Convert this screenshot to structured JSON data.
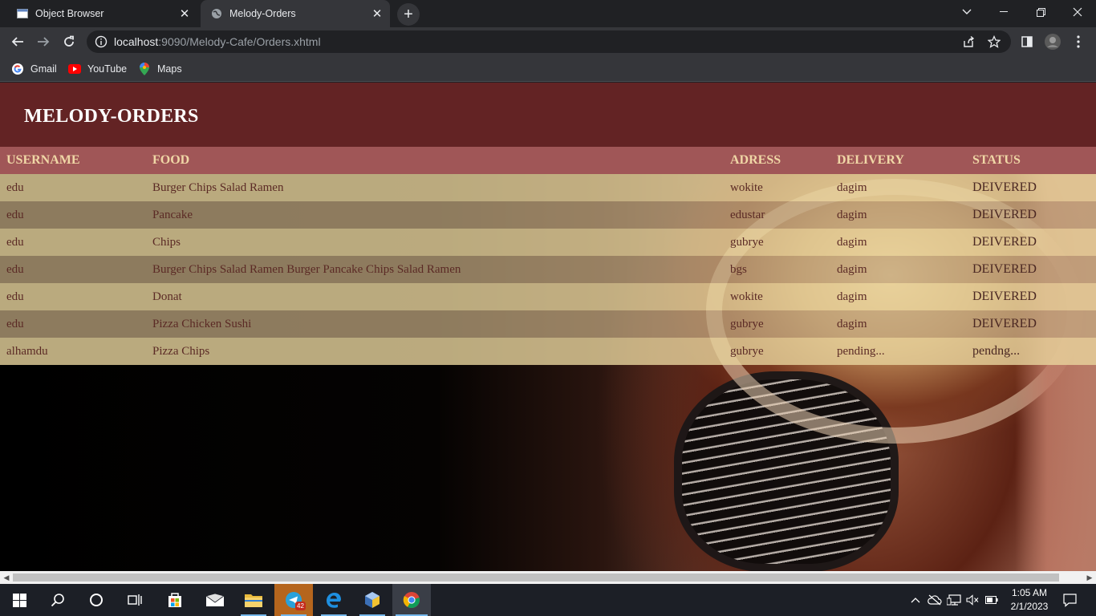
{
  "browser": {
    "tabs": [
      {
        "title": "Object Browser",
        "favicon": "window-icon",
        "active": false
      },
      {
        "title": "Melody-Orders",
        "favicon": "globe-icon",
        "active": true
      }
    ],
    "address": {
      "host": "localhost",
      "rest": ":9090/Melody-Cafe/Orders.xhtml"
    },
    "bookmarks": [
      {
        "label": "Gmail",
        "icon": "google-icon"
      },
      {
        "label": "YouTube",
        "icon": "youtube-icon"
      },
      {
        "label": "Maps",
        "icon": "maps-icon"
      }
    ]
  },
  "page": {
    "title": "MELODY-ORDERS",
    "columns": [
      "USERNAME",
      "FOOD",
      "ADRESS",
      "DELIVERY",
      "STATUS"
    ],
    "rows": [
      {
        "username": "edu",
        "food": "Burger Chips Salad Ramen",
        "address": "wokite",
        "delivery": "dagim",
        "status": "DEIVERED"
      },
      {
        "username": "edu",
        "food": "Pancake",
        "address": "edustar",
        "delivery": "dagim",
        "status": "DEIVERED"
      },
      {
        "username": "edu",
        "food": "Chips",
        "address": "gubrye",
        "delivery": "dagim",
        "status": "DEIVERED"
      },
      {
        "username": "edu",
        "food": "Burger Chips Salad Ramen Burger Pancake Chips Salad Ramen",
        "address": "bgs",
        "delivery": "dagim",
        "status": "DEIVERED"
      },
      {
        "username": "edu",
        "food": "Donat",
        "address": "wokite",
        "delivery": "dagim",
        "status": "DEIVERED"
      },
      {
        "username": "edu",
        "food": "Pizza Chicken Sushi",
        "address": "gubrye",
        "delivery": "dagim",
        "status": "DEIVERED"
      },
      {
        "username": "alhamdu",
        "food": "Pizza Chips",
        "address": "gubrye",
        "delivery": "pending...",
        "status": "pendng..."
      }
    ],
    "colors": {
      "header_bg": "#632324",
      "table_header_bg": "#a05657",
      "table_header_text": "#f0d7a6"
    }
  },
  "taskbar": {
    "time": "1:05 AM",
    "date": "2/1/2023",
    "telegram_badge": "42"
  }
}
